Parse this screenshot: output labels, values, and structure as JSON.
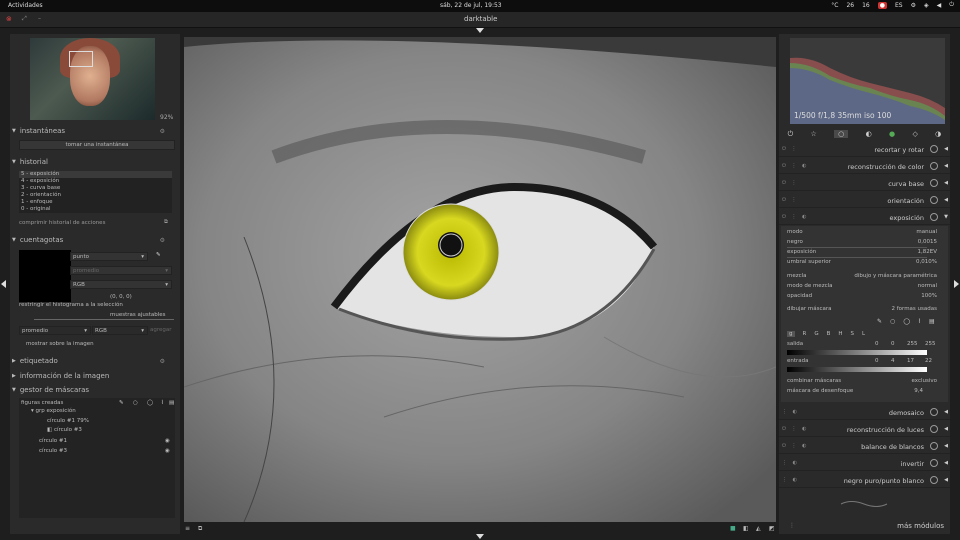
{
  "topbar": {
    "activities": "Actividades",
    "clock": "sáb, 22 de jul, 19:53",
    "tray": [
      "26",
      "16",
      "ES"
    ],
    "temp_unit": "°C"
  },
  "window": {
    "title": "darktable"
  },
  "left": {
    "zoom": "92%",
    "snapshots": {
      "title": "instantáneas",
      "button": "tomar una instantánea"
    },
    "history": {
      "title": "historial",
      "items": [
        "5 - exposición",
        "4 - exposición",
        "3 - curva base",
        "2 - orientación",
        "1 - enfoque",
        "0 - original"
      ],
      "compress": "comprimir historial de acciones"
    },
    "picker": {
      "title": "cuentagotas",
      "mode": "punto",
      "stat": "promedio",
      "space": "RGB",
      "values": "(0, 0, 0)",
      "restrict": "restringir el histograma a la selección",
      "samples": "muestras ajustables",
      "avg": "promedio",
      "rgb2": "RGB",
      "add": "agregar",
      "overlay": "mostrar sobre la imagen"
    },
    "tags": "etiquetado",
    "info": "información de la imagen",
    "masks": {
      "title": "gestor de máscaras",
      "created": "figuras creadas",
      "items": [
        "grp exposición",
        "círculo #1 79%",
        "círculo #3",
        "círculo #1",
        "círculo #3"
      ]
    }
  },
  "right": {
    "hist_label": "1/500 f/1,8 35mm iso 100",
    "modules_top": [
      "recortar y rotar",
      "reconstrucción de color",
      "curva base",
      "orientación",
      "exposición"
    ],
    "exposure": {
      "mode_k": "modo",
      "mode_v": "manual",
      "black_k": "negro",
      "black_v": "0,0015",
      "exp_k": "exposición",
      "exp_v": "1,82EV",
      "thr_k": "umbral superior",
      "thr_v": "0,010%",
      "blend_k": "mezcla",
      "blend_v": "dibujo y máscara paramétrica",
      "bmode_k": "modo de mezcla",
      "bmode_v": "normal",
      "opac_k": "opacidad",
      "opac_v": "100%",
      "draw_k": "dibujar máscara",
      "draw_v": "2 formas usadas",
      "channels": [
        "g",
        "R",
        "G",
        "B",
        "H",
        "S",
        "L"
      ],
      "out_k": "salida",
      "out_v": [
        "0",
        "0",
        "255",
        "255"
      ],
      "in_k": "entrada",
      "in_v": [
        "0",
        "4",
        "17",
        "22"
      ],
      "comb_k": "combinar máscaras",
      "comb_v": "exclusivo",
      "blur_k": "máscara de desenfoque",
      "blur_v": "9,4"
    },
    "modules_bottom": [
      "demosaico",
      "reconstrucción de luces",
      "balance de blancos",
      "invertir",
      "negro puro/punto blanco"
    ],
    "more": "más módulos"
  }
}
